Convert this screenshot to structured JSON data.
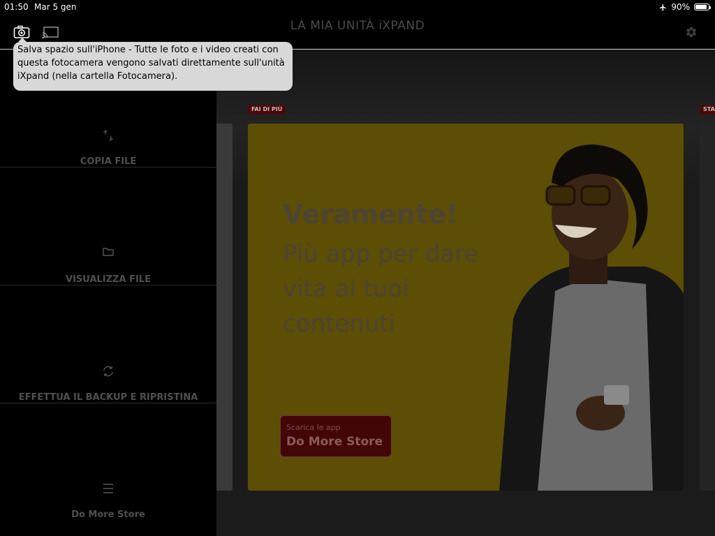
{
  "status_bar": {
    "time": "01:50",
    "date": "Mar 5 gen",
    "airplane_icon": "airplane-icon",
    "battery_percent": "90%",
    "battery_level": 0.9
  },
  "header": {
    "title": "LA MIA UNITÀ iXPAND",
    "camera_icon": "camera-icon",
    "cast_icon": "cast-icon",
    "settings_icon": "gear-icon"
  },
  "tooltip": {
    "text": "Salva spazio sull'iPhone - Tutte le foto e i video creati con questa fotocamera vengono salvati direttamente sull'unità iXpand (nella cartella Fotocamera)."
  },
  "sidebar": {
    "items": [
      {
        "label": "COPIA FILE",
        "icon": "copy-arrows-icon"
      },
      {
        "label": "VISUALIZZA FILE",
        "icon": "folder-icon"
      },
      {
        "label": "EFFETTUA IL BACKUP E RIPRISTINA",
        "icon": "sync-icon"
      },
      {
        "label": "Do More Store",
        "icon": "menu-icon"
      }
    ]
  },
  "carousel": {
    "tag_current": "FAI DI PIÙ",
    "tag_next": "STA",
    "card": {
      "headline": "Veramente!",
      "subtitle": "Più app per dare vita ai tuoi contenuti",
      "button_small": "Scarica le app",
      "button_large": "Do More Store"
    }
  },
  "colors": {
    "card_bg": "#5c4e05",
    "tag_bg": "#4a0a0a",
    "button_bg": "#430608"
  }
}
